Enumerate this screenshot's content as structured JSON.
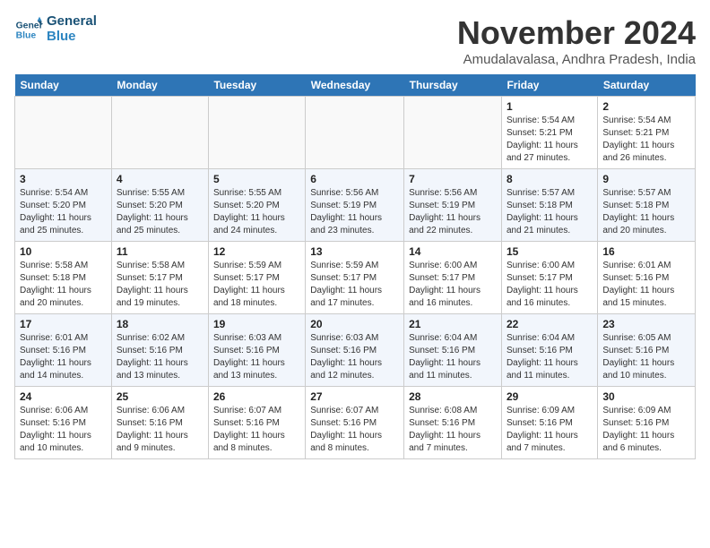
{
  "logo": {
    "line1": "General",
    "line2": "Blue"
  },
  "title": "November 2024",
  "subtitle": "Amudalavalasa, Andhra Pradesh, India",
  "headers": [
    "Sunday",
    "Monday",
    "Tuesday",
    "Wednesday",
    "Thursday",
    "Friday",
    "Saturday"
  ],
  "weeks": [
    [
      {
        "day": "",
        "info": ""
      },
      {
        "day": "",
        "info": ""
      },
      {
        "day": "",
        "info": ""
      },
      {
        "day": "",
        "info": ""
      },
      {
        "day": "",
        "info": ""
      },
      {
        "day": "1",
        "info": "Sunrise: 5:54 AM\nSunset: 5:21 PM\nDaylight: 11 hours and 27 minutes."
      },
      {
        "day": "2",
        "info": "Sunrise: 5:54 AM\nSunset: 5:21 PM\nDaylight: 11 hours and 26 minutes."
      }
    ],
    [
      {
        "day": "3",
        "info": "Sunrise: 5:54 AM\nSunset: 5:20 PM\nDaylight: 11 hours and 25 minutes."
      },
      {
        "day": "4",
        "info": "Sunrise: 5:55 AM\nSunset: 5:20 PM\nDaylight: 11 hours and 25 minutes."
      },
      {
        "day": "5",
        "info": "Sunrise: 5:55 AM\nSunset: 5:20 PM\nDaylight: 11 hours and 24 minutes."
      },
      {
        "day": "6",
        "info": "Sunrise: 5:56 AM\nSunset: 5:19 PM\nDaylight: 11 hours and 23 minutes."
      },
      {
        "day": "7",
        "info": "Sunrise: 5:56 AM\nSunset: 5:19 PM\nDaylight: 11 hours and 22 minutes."
      },
      {
        "day": "8",
        "info": "Sunrise: 5:57 AM\nSunset: 5:18 PM\nDaylight: 11 hours and 21 minutes."
      },
      {
        "day": "9",
        "info": "Sunrise: 5:57 AM\nSunset: 5:18 PM\nDaylight: 11 hours and 20 minutes."
      }
    ],
    [
      {
        "day": "10",
        "info": "Sunrise: 5:58 AM\nSunset: 5:18 PM\nDaylight: 11 hours and 20 minutes."
      },
      {
        "day": "11",
        "info": "Sunrise: 5:58 AM\nSunset: 5:17 PM\nDaylight: 11 hours and 19 minutes."
      },
      {
        "day": "12",
        "info": "Sunrise: 5:59 AM\nSunset: 5:17 PM\nDaylight: 11 hours and 18 minutes."
      },
      {
        "day": "13",
        "info": "Sunrise: 5:59 AM\nSunset: 5:17 PM\nDaylight: 11 hours and 17 minutes."
      },
      {
        "day": "14",
        "info": "Sunrise: 6:00 AM\nSunset: 5:17 PM\nDaylight: 11 hours and 16 minutes."
      },
      {
        "day": "15",
        "info": "Sunrise: 6:00 AM\nSunset: 5:17 PM\nDaylight: 11 hours and 16 minutes."
      },
      {
        "day": "16",
        "info": "Sunrise: 6:01 AM\nSunset: 5:16 PM\nDaylight: 11 hours and 15 minutes."
      }
    ],
    [
      {
        "day": "17",
        "info": "Sunrise: 6:01 AM\nSunset: 5:16 PM\nDaylight: 11 hours and 14 minutes."
      },
      {
        "day": "18",
        "info": "Sunrise: 6:02 AM\nSunset: 5:16 PM\nDaylight: 11 hours and 13 minutes."
      },
      {
        "day": "19",
        "info": "Sunrise: 6:03 AM\nSunset: 5:16 PM\nDaylight: 11 hours and 13 minutes."
      },
      {
        "day": "20",
        "info": "Sunrise: 6:03 AM\nSunset: 5:16 PM\nDaylight: 11 hours and 12 minutes."
      },
      {
        "day": "21",
        "info": "Sunrise: 6:04 AM\nSunset: 5:16 PM\nDaylight: 11 hours and 11 minutes."
      },
      {
        "day": "22",
        "info": "Sunrise: 6:04 AM\nSunset: 5:16 PM\nDaylight: 11 hours and 11 minutes."
      },
      {
        "day": "23",
        "info": "Sunrise: 6:05 AM\nSunset: 5:16 PM\nDaylight: 11 hours and 10 minutes."
      }
    ],
    [
      {
        "day": "24",
        "info": "Sunrise: 6:06 AM\nSunset: 5:16 PM\nDaylight: 11 hours and 10 minutes."
      },
      {
        "day": "25",
        "info": "Sunrise: 6:06 AM\nSunset: 5:16 PM\nDaylight: 11 hours and 9 minutes."
      },
      {
        "day": "26",
        "info": "Sunrise: 6:07 AM\nSunset: 5:16 PM\nDaylight: 11 hours and 8 minutes."
      },
      {
        "day": "27",
        "info": "Sunrise: 6:07 AM\nSunset: 5:16 PM\nDaylight: 11 hours and 8 minutes."
      },
      {
        "day": "28",
        "info": "Sunrise: 6:08 AM\nSunset: 5:16 PM\nDaylight: 11 hours and 7 minutes."
      },
      {
        "day": "29",
        "info": "Sunrise: 6:09 AM\nSunset: 5:16 PM\nDaylight: 11 hours and 7 minutes."
      },
      {
        "day": "30",
        "info": "Sunrise: 6:09 AM\nSunset: 5:16 PM\nDaylight: 11 hours and 6 minutes."
      }
    ]
  ]
}
